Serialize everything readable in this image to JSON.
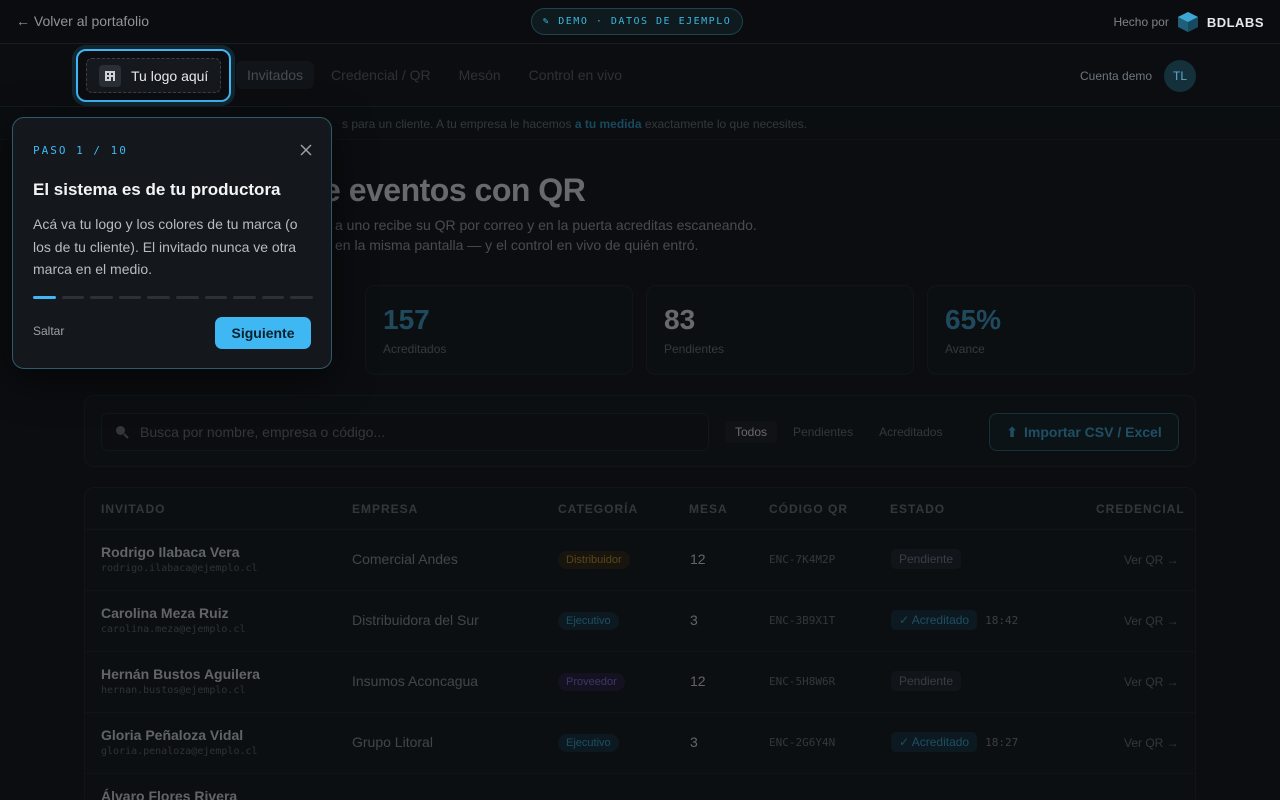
{
  "topbar": {
    "back_label": "← Volver al portafolio",
    "demo_label": "DEMO · DATOS DE EJEMPLO",
    "made_by_label": "Hecho por",
    "brand": "BDLABS"
  },
  "nav": {
    "logo_label": "Tu logo aquí",
    "tabs": [
      {
        "label": "Invitados",
        "active": true
      },
      {
        "label": "Credencial / QR",
        "active": false
      },
      {
        "label": "Mesón",
        "active": false
      },
      {
        "label": "Control en vivo",
        "active": false
      }
    ],
    "account_label": "Cuenta demo",
    "avatar_initials": "TL"
  },
  "banner": {
    "text_before": "s para un cliente. A tu empresa le hacemos ",
    "highlight": "a tu medida",
    "text_after": " exactamente lo que necesites."
  },
  "hero": {
    "title": "e eventos con QR",
    "subtitle_line1": "a uno recibe su QR por correo y en la puerta acreditas escaneando.",
    "subtitle_line2": "en la misma pantalla — y el control en vivo de quién entró."
  },
  "stats": [
    {
      "value": "157",
      "label": "Acreditados",
      "accent": true
    },
    {
      "value": "83",
      "label": "Pendientes",
      "accent": false
    },
    {
      "value": "65%",
      "label": "Avance",
      "accent": true
    }
  ],
  "toolbar": {
    "search_placeholder": "Busca por nombre, empresa o código...",
    "filters": [
      {
        "label": "Todos",
        "active": true
      },
      {
        "label": "Pendientes",
        "active": false
      },
      {
        "label": "Acreditados",
        "active": false
      }
    ],
    "import_label": "Importar CSV / Excel"
  },
  "table": {
    "headers": [
      "INVITADO",
      "EMPRESA",
      "CATEGORÍA",
      "MESA",
      "CÓDIGO QR",
      "ESTADO",
      "CREDENCIAL"
    ],
    "rows": [
      {
        "name": "Rodrigo Ilabaca Vera",
        "email": "rodrigo.ilabaca@ejemplo.cl",
        "company": "Comercial Andes",
        "category": "Distribuidor",
        "cat_class": "dist",
        "mesa": "12",
        "code": "ENC-7K4M2P",
        "status": "Pendiente",
        "status_class": "pend",
        "time": "",
        "action": "Ver QR →"
      },
      {
        "name": "Carolina Meza Ruiz",
        "email": "carolina.meza@ejemplo.cl",
        "company": "Distribuidora del Sur",
        "category": "Ejecutivo",
        "cat_class": "exec",
        "mesa": "3",
        "code": "ENC-3B9X1T",
        "status": "✓ Acreditado",
        "status_class": "acred",
        "time": "18:42",
        "action": "Ver QR →"
      },
      {
        "name": "Hernán Bustos Aguilera",
        "email": "hernan.bustos@ejemplo.cl",
        "company": "Insumos Aconcagua",
        "category": "Proveedor",
        "cat_class": "prov",
        "mesa": "12",
        "code": "ENC-5H8W6R",
        "status": "Pendiente",
        "status_class": "pend",
        "time": "",
        "action": "Ver QR →"
      },
      {
        "name": "Gloria Peñaloza Vidal",
        "email": "gloria.penaloza@ejemplo.cl",
        "company": "Grupo Litoral",
        "category": "Ejecutivo",
        "cat_class": "exec",
        "mesa": "3",
        "code": "ENC-2G6Y4N",
        "status": "✓ Acreditado",
        "status_class": "acred",
        "time": "18:27",
        "action": "Ver QR →"
      },
      {
        "name": "Álvaro Flores Rivera",
        "email": "",
        "company": "",
        "category": "",
        "cat_class": "",
        "mesa": "",
        "code": "",
        "status": "",
        "status_class": "",
        "time": "",
        "action": ""
      }
    ]
  },
  "tour": {
    "step_label": "PASO 1 / 10",
    "title": "El sistema es de tu productora",
    "body": "Acá va tu logo y los colores de tu marca (o los de tu cliente). El invitado nunca ve otra marca en el medio.",
    "current_step": 1,
    "total_steps": 10,
    "skip_label": "Saltar",
    "next_label": "Siguiente"
  }
}
